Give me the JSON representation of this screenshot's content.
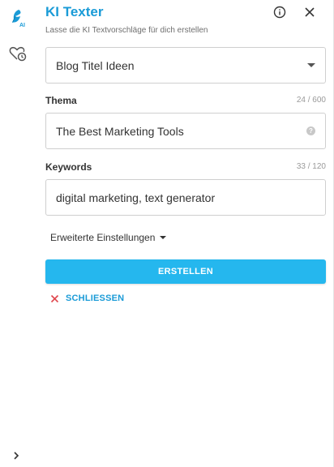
{
  "header": {
    "title": "KI Texter",
    "subtitle": "Lasse die KI Textvorschläge für dich erstellen"
  },
  "rail": {
    "logo_badge": "AI"
  },
  "template_select": {
    "value": "Blog Titel Ideen"
  },
  "thema": {
    "label": "Thema",
    "counter": "24 / 600",
    "value": "The Best Marketing Tools",
    "help_glyph": "?"
  },
  "keywords": {
    "label": "Keywords",
    "counter": "33 / 120",
    "value": "digital marketing, text generator"
  },
  "advanced": {
    "label": "Erweiterte Einstellungen"
  },
  "actions": {
    "create_label": "ERSTELLEN",
    "close_label": "SCHLIESSEN"
  },
  "colors": {
    "accent": "#1a9bd7",
    "button": "#25b7ee",
    "close_x": "#e0484f"
  },
  "icons": {
    "logo": "feather-ai-icon",
    "rail_heart": "heart-clock-icon",
    "info": "info-icon",
    "close": "close-icon",
    "expand": "chevron-right-icon",
    "select_caret": "caret-down-icon",
    "help": "help-icon",
    "cancel": "x-icon"
  }
}
